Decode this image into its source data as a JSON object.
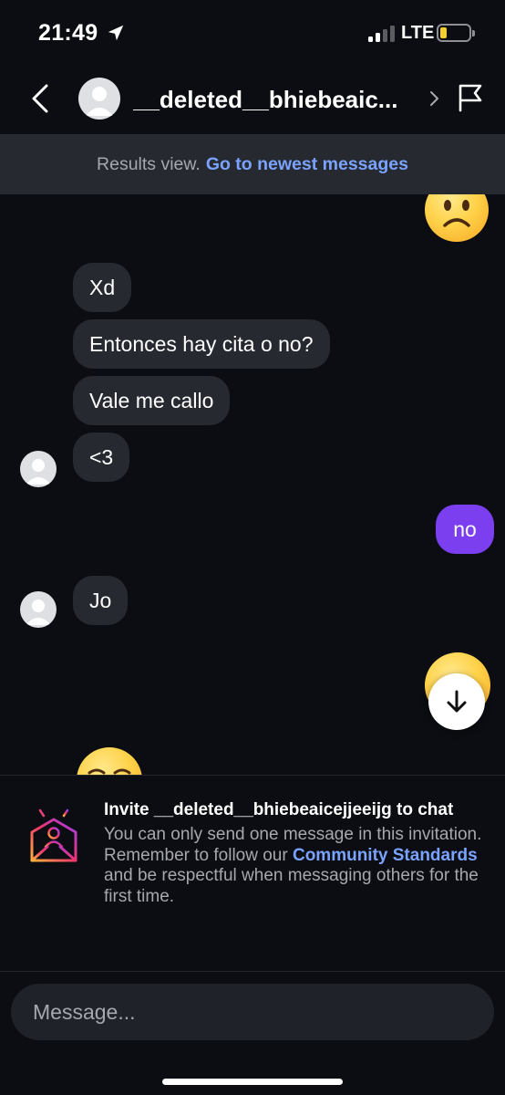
{
  "status_bar": {
    "time": "21:49",
    "network": "LTE",
    "signal_bars": 2,
    "battery_level": 0.2
  },
  "header": {
    "title": "__deleted__bhiebeaic...",
    "back_icon": "chevron-left-icon",
    "flag_icon": "flag-icon"
  },
  "results_banner": {
    "label": "Results view.",
    "link": "Go to newest messages"
  },
  "messages": [
    {
      "kind": "emoji",
      "value": "frowning-face",
      "side": "out"
    },
    {
      "kind": "text",
      "text": "Xd",
      "side": "in"
    },
    {
      "kind": "text",
      "text": "Entonces hay cita o no?",
      "side": "in"
    },
    {
      "kind": "text",
      "text": "Vale me callo",
      "side": "in"
    },
    {
      "kind": "text",
      "text": "<3",
      "side": "in"
    },
    {
      "kind": "text",
      "text": "no",
      "side": "out"
    },
    {
      "kind": "text",
      "text": "Jo",
      "side": "in"
    },
    {
      "kind": "emoji",
      "value": "smiling-face",
      "side": "out"
    },
    {
      "kind": "emoji",
      "value": "relieved-face",
      "side": "in"
    }
  ],
  "invite": {
    "title": "Invite __deleted__bhiebeaicejjeeijg to chat",
    "body_before": "You can only send one message in this invitation. Remember to follow our",
    "link": "Community Standards",
    "body_after": "and be respectful when messaging others for the first time."
  },
  "composer": {
    "placeholder": "Message..."
  },
  "colors": {
    "background": "#0b0d12",
    "incoming_bubble": "#262a30",
    "outgoing_bubble": "#7b3ff0",
    "link": "#7aa3ff"
  }
}
